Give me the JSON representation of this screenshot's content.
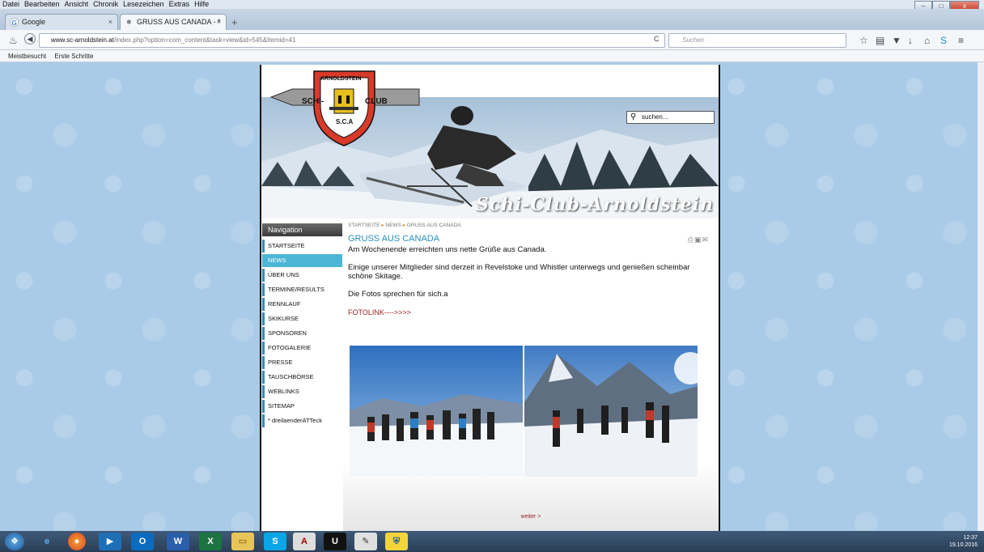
{
  "menubar": [
    "Datei",
    "Bearbeiten",
    "Ansicht",
    "Chronik",
    "Lesezeichen",
    "Extras",
    "Hilfe"
  ],
  "tabs": [
    {
      "label": "Google",
      "icon": "google-icon"
    },
    {
      "label": "GRUSS AUS CANADA - * Sc...",
      "icon": "snowflake-icon"
    }
  ],
  "url": {
    "host": "www.sc-arnoldstein.at",
    "path": "/index.php?option=com_content&task=view&id=545&Itemid=41"
  },
  "browser_search": {
    "placeholder": "Suchen"
  },
  "bookmarks": [
    "Meistbesucht",
    "Erste Schritte"
  ],
  "site": {
    "logo_top": "ARNOLDSTEIN",
    "logo_left": "SCHI-",
    "logo_right": "CLUB",
    "logo_bottom": "S.C.A",
    "header_title": "Schi-Club-Arnoldstein",
    "search_placeholder": "suchen..."
  },
  "navigation": {
    "title": "Navigation",
    "items": [
      {
        "label": "STARTSEITE",
        "active": false
      },
      {
        "label": "NEWS",
        "active": true
      },
      {
        "label": "ÜBER UNS",
        "active": false
      },
      {
        "label": "TERMINE/RESULTS",
        "active": false
      },
      {
        "label": "RENNLAUF",
        "active": false
      },
      {
        "label": "SKIKURSE",
        "active": false
      },
      {
        "label": "SPONSOREN",
        "active": false
      },
      {
        "label": "FOTOGALERIE",
        "active": false
      },
      {
        "label": "PRESSE",
        "active": false
      },
      {
        "label": "TAUSCHBÖRSE",
        "active": false
      },
      {
        "label": "WEBLINKS",
        "active": false
      },
      {
        "label": "SITEMAP",
        "active": false
      },
      {
        "label": "* dreilaenderATTeck",
        "active": false
      }
    ]
  },
  "article": {
    "breadcrumb": [
      "STARTSEITE",
      "NEWS",
      "GRUSS AUS CANADA"
    ],
    "title": "GRUSS AUS CANADA",
    "p1": "Am Wochenende erreichten uns nette Grüße aus Canada.",
    "p2": "Einige unserer Mitglieder sind derzeit in Revelstoke und Whistler unterwegs und genießen scheinbar schöne Skitage.",
    "p3": "Die Fotos sprechen für sich.a",
    "link": "FOTOLINK---->>>>",
    "more": "weiter >"
  },
  "taskbar": {
    "time": "12:37",
    "date": "19.10.2016"
  },
  "colors": {
    "accent": "#2a8fbf",
    "nav_active": "#4cb6d6",
    "link": "#9a2020",
    "page_bg": "#a9cbe7"
  }
}
